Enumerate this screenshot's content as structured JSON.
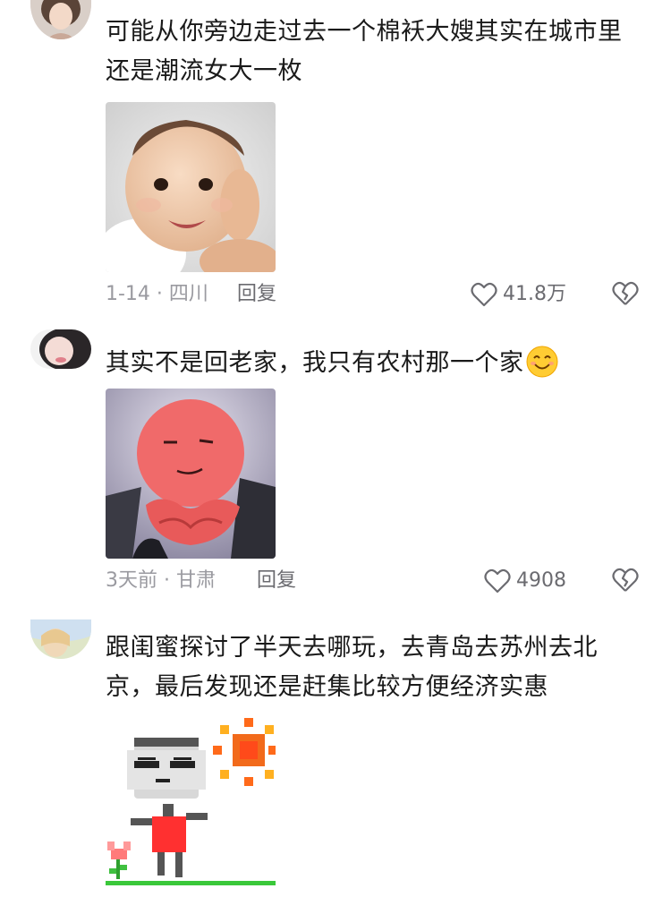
{
  "comments": [
    {
      "text_line1": "可能从你旁边走过去一个棉袄大嫂其实在城市里",
      "text_line2": "还是潮流女大一枚",
      "meta": "1-14 · 四川",
      "reply_label": "回复",
      "likes": "41.8万"
    },
    {
      "text": "其实不是回老家，我只有农村那一个家",
      "meta": "3天前 · 甘肃",
      "reply_label": "回复",
      "likes": "4908"
    },
    {
      "text_line1": "跟闺蜜探讨了半天去哪玩，去青岛去苏州去北",
      "text_line2": "京，最后发现还是赶集比较方便经济实惠"
    }
  ],
  "icons": {
    "like": "heart-outline-icon",
    "dislike": "broken-heart-icon",
    "emoji": "smiling-face-emoji"
  }
}
